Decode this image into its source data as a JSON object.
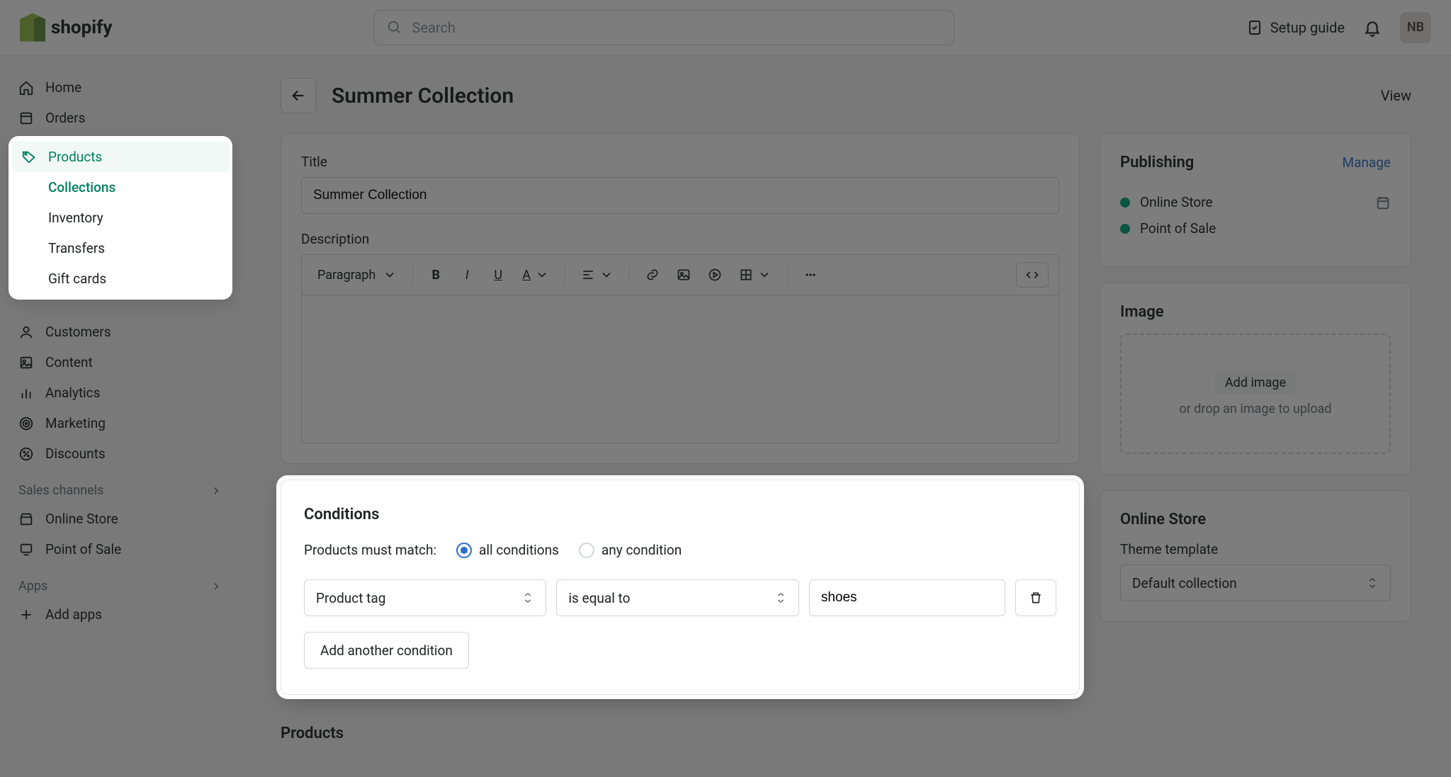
{
  "topbar": {
    "logo_text": "shopify",
    "search_placeholder": "Search",
    "setup_guide": "Setup guide",
    "avatar_initials": "NB"
  },
  "sidebar": {
    "items": [
      {
        "label": "Home",
        "icon": "home-icon"
      },
      {
        "label": "Orders",
        "icon": "orders-icon"
      }
    ],
    "products": {
      "label": "Products",
      "sub": [
        {
          "label": "Collections",
          "current": true
        },
        {
          "label": "Inventory"
        },
        {
          "label": "Transfers"
        },
        {
          "label": "Gift cards"
        }
      ]
    },
    "items2": [
      {
        "label": "Customers",
        "icon": "customers-icon"
      },
      {
        "label": "Content",
        "icon": "content-icon"
      },
      {
        "label": "Analytics",
        "icon": "analytics-icon"
      },
      {
        "label": "Marketing",
        "icon": "marketing-icon"
      },
      {
        "label": "Discounts",
        "icon": "discounts-icon"
      }
    ],
    "sales_channels": {
      "heading": "Sales channels",
      "items": [
        {
          "label": "Online Store"
        },
        {
          "label": "Point of Sale"
        }
      ]
    },
    "apps": {
      "heading": "Apps",
      "add_label": "Add apps"
    }
  },
  "page": {
    "back_aria": "Back",
    "title": "Summer Collection",
    "view": "View"
  },
  "editor": {
    "title_label": "Title",
    "title_value": "Summer Collection",
    "description_label": "Description",
    "paragraph_label": "Paragraph"
  },
  "conditions": {
    "heading": "Conditions",
    "must_match": "Products must match:",
    "opt_all": "all conditions",
    "opt_any": "any condition",
    "selected": "all",
    "rule": {
      "field": "Product tag",
      "operator": "is equal to",
      "value": "shoes"
    },
    "add_another": "Add another condition"
  },
  "products_section": {
    "heading": "Products"
  },
  "publishing": {
    "heading": "Publishing",
    "manage": "Manage",
    "items": [
      {
        "label": "Online Store",
        "has_calendar": true
      },
      {
        "label": "Point of Sale"
      }
    ]
  },
  "image_card": {
    "heading": "Image",
    "add": "Add image",
    "drop": "or drop an image to upload"
  },
  "online_store": {
    "heading": "Online Store",
    "theme_label": "Theme template",
    "theme_value": "Default collection"
  }
}
